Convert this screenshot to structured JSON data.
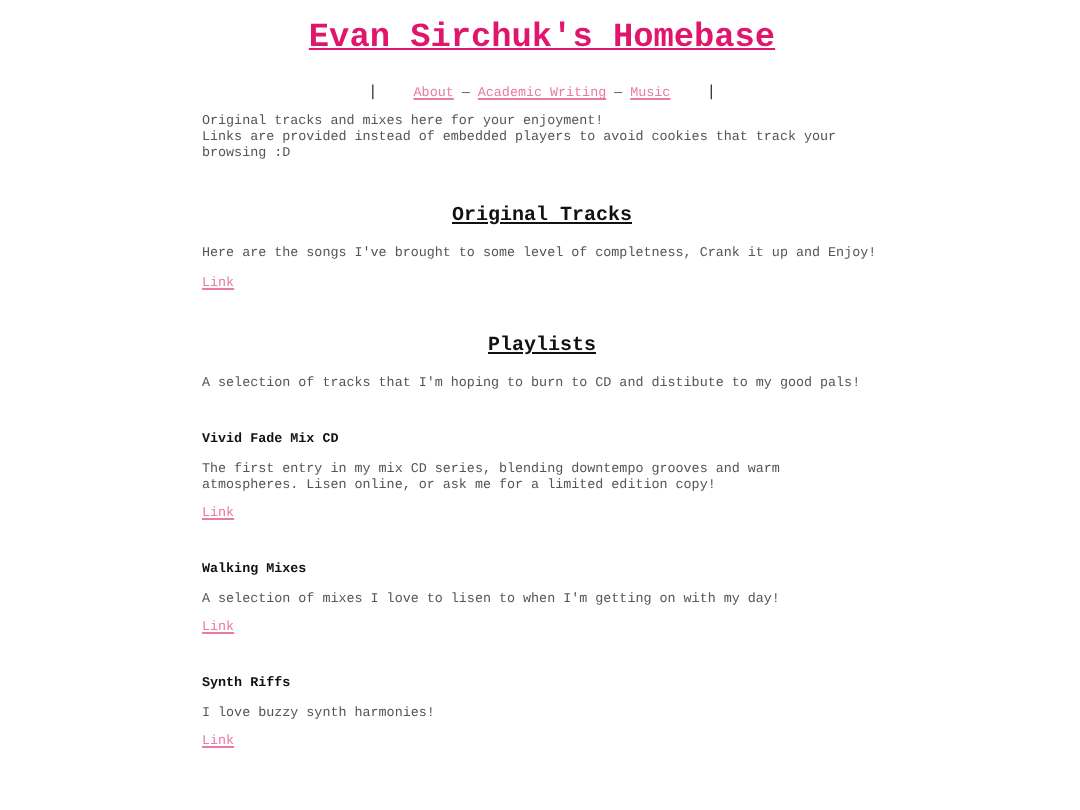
{
  "title": "Evan Sirchuk's Homebase",
  "nav": {
    "left_bar": "|",
    "items": [
      {
        "label": "About"
      },
      {
        "label": "Academic Writing"
      },
      {
        "label": "Music"
      }
    ],
    "separator": "—",
    "right_bar": "|"
  },
  "intro": [
    "Original tracks and mixes here for your enjoyment!",
    "Links are provided instead of embedded players to avoid cookies that track your browsing :D"
  ],
  "sections": [
    {
      "heading": "Original Tracks",
      "description": "Here are the songs I've brought to some level of completness, Crank it up and Enjoy!",
      "link": "Link"
    },
    {
      "heading": "Playlists",
      "description": "A selection of tracks that I'm hoping to burn to CD and distibute to my good pals!",
      "items": [
        {
          "title": "Vivid Fade Mix CD",
          "description": "The first entry in my mix CD series, blending downtempo grooves and warm atmospheres. Lisen online, or ask me for a limited edition copy!",
          "link": "Link"
        },
        {
          "title": "Walking Mixes",
          "description": "A selection of mixes I love to lisen to when I'm getting on with my day!",
          "link": "Link"
        },
        {
          "title": "Synth Riffs",
          "description": "I love buzzy synth harmonies!",
          "link": "Link"
        }
      ]
    }
  ]
}
